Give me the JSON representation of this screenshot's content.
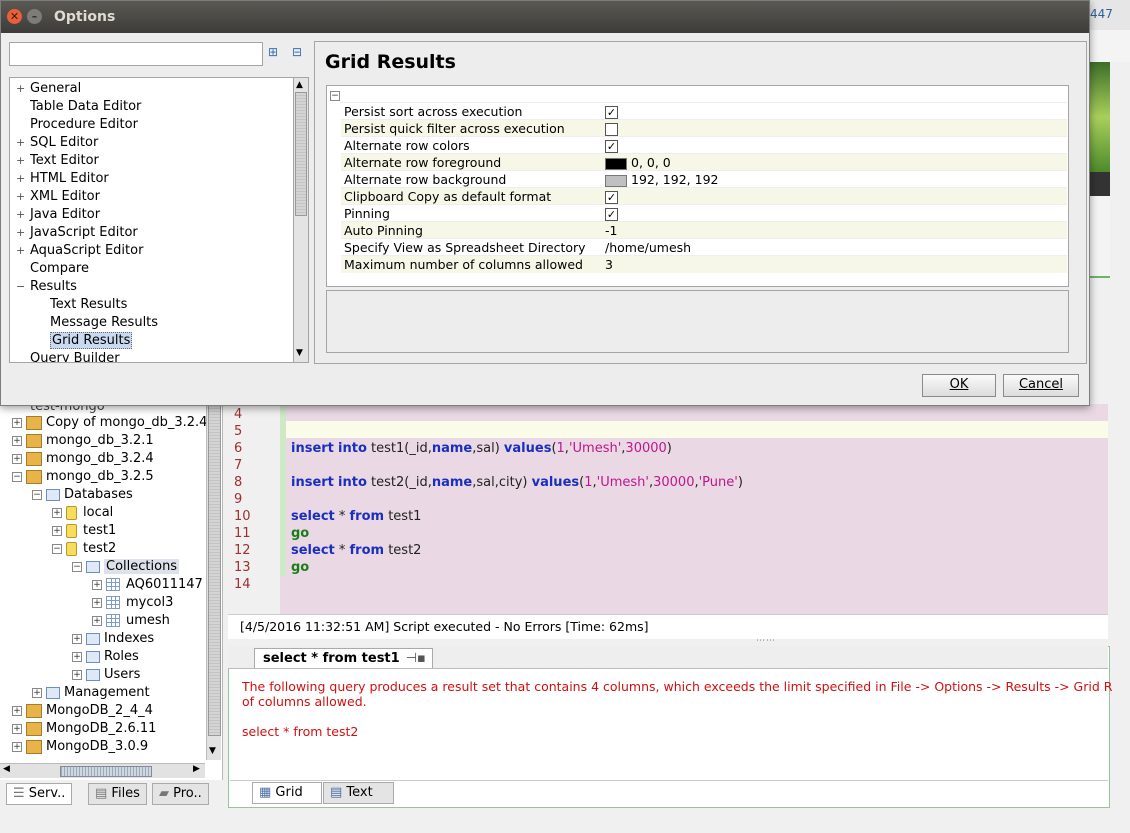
{
  "dialog": {
    "title": "Options",
    "close_glyph": "✕",
    "min_glyph": "–",
    "tree": [
      {
        "label": "General",
        "expander": "+"
      },
      {
        "label": "Table Data Editor",
        "expander": ""
      },
      {
        "label": "Procedure Editor",
        "expander": ""
      },
      {
        "label": "SQL Editor",
        "expander": "+"
      },
      {
        "label": "Text Editor",
        "expander": "+"
      },
      {
        "label": "HTML Editor",
        "expander": "+"
      },
      {
        "label": "XML Editor",
        "expander": "+"
      },
      {
        "label": "Java Editor",
        "expander": "+"
      },
      {
        "label": "JavaScript Editor",
        "expander": "+"
      },
      {
        "label": "AquaScript Editor",
        "expander": "+"
      },
      {
        "label": "Compare",
        "expander": ""
      },
      {
        "label": "Results",
        "expander": "−"
      },
      {
        "label": "Text Results",
        "expander": "",
        "indent": 1
      },
      {
        "label": "Message Results",
        "expander": "",
        "indent": 1
      },
      {
        "label": "Grid Results",
        "expander": "",
        "indent": 1,
        "selected": true
      },
      {
        "label": "Query Builder",
        "expander": ""
      }
    ],
    "panel_title": "Grid Results",
    "group_collapse": "−",
    "properties": [
      {
        "label": "Persist sort across execution",
        "type": "check",
        "checked": true
      },
      {
        "label": "Persist quick filter across execution",
        "type": "check",
        "checked": false
      },
      {
        "label": "Alternate row colors",
        "type": "check",
        "checked": true
      },
      {
        "label": "Alternate row foreground",
        "type": "color",
        "color": "#000000",
        "value": "0, 0, 0"
      },
      {
        "label": "Alternate row background",
        "type": "color",
        "color": "#c0c0c0",
        "value": "192, 192, 192"
      },
      {
        "label": "Clipboard Copy as default format",
        "type": "check",
        "checked": true
      },
      {
        "label": "Pinning",
        "type": "check",
        "checked": true
      },
      {
        "label": "Auto Pinning",
        "type": "text",
        "value": "-1"
      },
      {
        "label": "Specify View as Spreadsheet Directory",
        "type": "text",
        "value": "/home/umesh"
      },
      {
        "label": "Maximum number of columns allowed",
        "type": "text",
        "value": "3"
      }
    ],
    "ok_label": "OK",
    "cancel_label": "Cancel"
  },
  "ide": {
    "corner_text": "447",
    "partial_tree_top": "test-mongo",
    "tree": [
      {
        "label": "Copy of mongo_db_3.2.4",
        "icon": "db"
      },
      {
        "label": "mongo_db_3.2.1",
        "icon": "db"
      },
      {
        "label": "mongo_db_3.2.4",
        "icon": "db"
      },
      {
        "label": "mongo_db_3.2.5",
        "icon": "db"
      },
      {
        "label": "Databases",
        "icon": "folder"
      },
      {
        "label": "local",
        "icon": "cyl"
      },
      {
        "label": "test1",
        "icon": "cyl"
      },
      {
        "label": "test2",
        "icon": "cyl"
      },
      {
        "label": "Collections",
        "icon": "folder"
      },
      {
        "label": "AQ6011147",
        "icon": "grid"
      },
      {
        "label": "mycol3",
        "icon": "grid"
      },
      {
        "label": "umesh",
        "icon": "grid"
      },
      {
        "label": "Indexes",
        "icon": "folder"
      },
      {
        "label": "Roles",
        "icon": "folder"
      },
      {
        "label": "Users",
        "icon": "folder"
      },
      {
        "label": "Management",
        "icon": "folder"
      },
      {
        "label": "MongoDB_2_4_4",
        "icon": "db"
      },
      {
        "label": "MongoDB_2.6.11",
        "icon": "db"
      },
      {
        "label": "MongoDB_3.0.9",
        "icon": "db"
      }
    ],
    "line_numbers": [
      "4",
      "5",
      "6",
      "7",
      "8",
      "9",
      "10",
      "11",
      "12",
      "13",
      "14"
    ],
    "code": {
      "l6": {
        "kw1": "insert",
        "kw2": "into",
        "tbl": " test1(_id,",
        "name": "name",
        "rest": ",sal) ",
        "values": "values",
        "open": "(",
        "n1": "1",
        "c1": ",",
        "s1": "'Umesh'",
        "c2": ",",
        "n2": "30000",
        "close": ")"
      },
      "l8": {
        "kw1": "insert",
        "kw2": "into",
        "tbl": " test2(_id,",
        "name": "name",
        "rest": ",sal,city) ",
        "values": "values",
        "open": "(",
        "n1": "1",
        "c1": ",",
        "s1": "'Umesh'",
        "c2": ",",
        "n2": "30000",
        "c3": ",",
        "s2": "'Pune'",
        "close": ")"
      },
      "l10": {
        "kw": "select",
        "mid": " * ",
        "kw2": "from",
        "rest": " test1"
      },
      "l11": "go",
      "l12": {
        "kw": "select",
        "mid": " * ",
        "kw2": "from",
        "rest": " test2"
      },
      "l13": "go"
    },
    "status": "[4/5/2016 11:32:51 AM] Script executed - No Errors [Time: 62ms]",
    "result_tab": "select * from test1",
    "error_line1": "The following query produces a result set that contains 4 columns, which exceeds the limit specified in File -> Options -> Results -> Grid R",
    "error_line2": "of columns allowed.",
    "error_line3": "select * from test2",
    "bottom_tabs": {
      "grid": "Grid",
      "text": "Text"
    },
    "left_tabs": {
      "serv": "Serv..",
      "files": "Files",
      "pro": "Pro.."
    }
  }
}
